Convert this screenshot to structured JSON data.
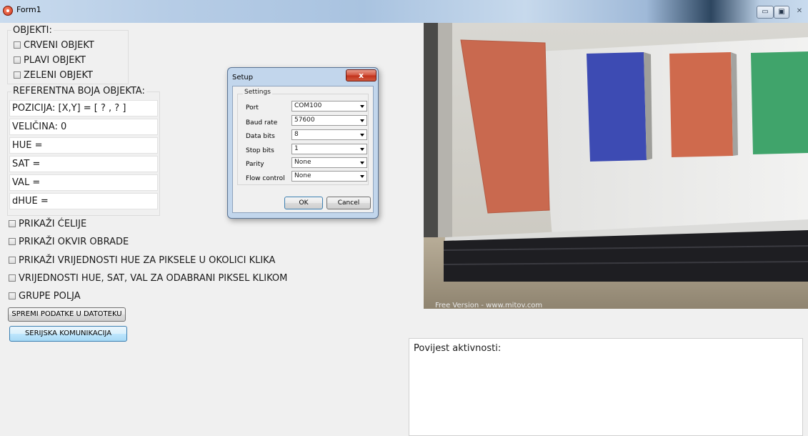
{
  "window": {
    "title": "Form1",
    "minimize_glyph": "▭",
    "maximize_glyph": "▣",
    "close_glyph": "✕"
  },
  "objekti": {
    "title": "OBJEKTI:",
    "items": [
      "CRVENI OBJEKT",
      "PLAVI OBJEKT",
      "ZELENI OBJEKT"
    ]
  },
  "referentna": {
    "title": "REFERENTNA BOJA OBJEKTA:",
    "fields": [
      "POZICIJA: [X,Y] = [ ? , ? ]",
      "VELIČINA: 0",
      "HUE =",
      "SAT =",
      "VAL =",
      "dHUE ="
    ]
  },
  "options": [
    "PRIKAŽI ĆELIJE",
    "PRIKAŽI OKVIR OBRADE",
    "PRIKAŽI VRIJEDNOSTI HUE ZA PIKSELE U OKOLICI KLIKA",
    "VRIJEDNOSTI HUE, SAT, VAL ZA ODABRANI PIKSEL KLIKOM",
    "GRUPE POLJA"
  ],
  "buttons": {
    "save": "SPREMI PODATKE U DATOTEKU",
    "serial": "SERIJSKA KOMUNIKACIJA"
  },
  "setup_dialog": {
    "title": "Setup",
    "close_glyph": "x",
    "group_title": "Settings",
    "rows": [
      {
        "label": "Port",
        "value": "COM100"
      },
      {
        "label": "Baud rate",
        "value": "57600"
      },
      {
        "label": "Data bits",
        "value": "8"
      },
      {
        "label": "Stop bits",
        "value": "1"
      },
      {
        "label": "Parity",
        "value": "None"
      },
      {
        "label": "Flow control",
        "value": "None"
      }
    ],
    "ok": "OK",
    "cancel": "Cancel"
  },
  "webcam": {
    "watermark": "Free Version - www.mitov.com",
    "sheet_colors": {
      "red": "#cf6a4f",
      "blue": "#3c4cb4",
      "green": "#3fa46a"
    }
  },
  "log": {
    "label": "Povijest aktivnosti:"
  }
}
